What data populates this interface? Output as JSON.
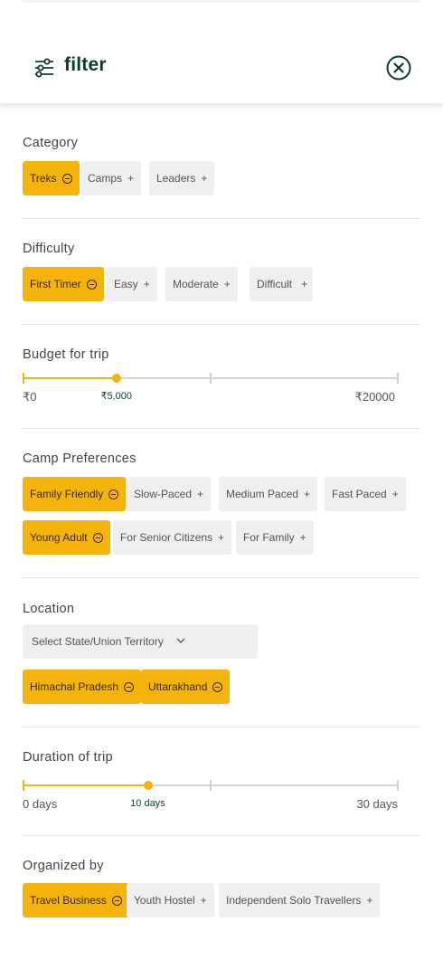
{
  "header": {
    "title": "filter"
  },
  "category": {
    "title": "Category",
    "chips": [
      {
        "label": "Treks",
        "selected": true
      },
      {
        "label": "Camps",
        "selected": false
      },
      {
        "label": "Leaders",
        "selected": false
      }
    ]
  },
  "difficulty": {
    "title": "Difficulty",
    "chips": [
      {
        "label": "First Timer",
        "selected": true
      },
      {
        "label": "Easy",
        "selected": false
      },
      {
        "label": "Moderate",
        "selected": false
      },
      {
        "label": "Difficult",
        "selected": false
      }
    ]
  },
  "budget": {
    "title": "Budget for trip",
    "min_label": "₹0",
    "max_label": "₹20000",
    "value_label": "₹5,000",
    "value": 5000,
    "min": 0,
    "max": 20000
  },
  "camp_preferences": {
    "title": "Camp Preferences",
    "chips": [
      {
        "label": "Family Friendly",
        "selected": true
      },
      {
        "label": "Slow-Paced",
        "selected": false
      },
      {
        "label": "Medium Paced",
        "selected": false
      },
      {
        "label": "Fast Paced",
        "selected": false
      },
      {
        "label": "Young Adult",
        "selected": true
      },
      {
        "label": "For Senior Citizens",
        "selected": false
      },
      {
        "label": "For Family",
        "selected": false
      }
    ]
  },
  "location": {
    "title": "Location",
    "select_placeholder": "Select State/Union Territory",
    "chips": [
      {
        "label": "Himachal Pradesh",
        "selected": true
      },
      {
        "label": "Uttarakhand",
        "selected": true
      }
    ]
  },
  "duration": {
    "title": "Duration of trip",
    "min_label": "0 days",
    "max_label": "30 days",
    "value_label": "10 days",
    "value": 10,
    "min": 0,
    "max": 30
  },
  "organized_by": {
    "title": "Organized by",
    "chips": [
      {
        "label": "Travel Business",
        "selected": true
      },
      {
        "label": "Youth Hostel",
        "selected": false
      },
      {
        "label": "Independent Solo Travellers",
        "selected": false
      }
    ]
  },
  "colors": {
    "accent": "#f5b40b",
    "brand_dark": "#0b3b2e",
    "chip_bg": "#efefef"
  }
}
